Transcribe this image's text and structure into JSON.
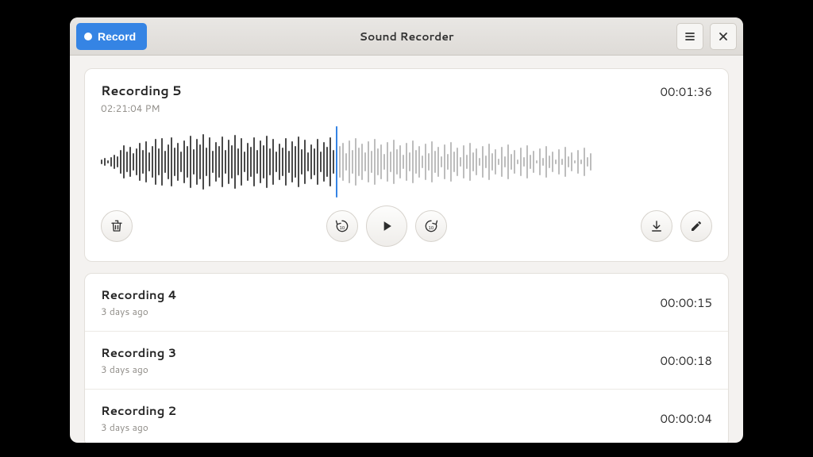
{
  "header": {
    "title": "Sound Recorder",
    "record_label": "Record"
  },
  "selected": {
    "title": "Recording 5",
    "timestamp": "02:21:04 PM",
    "duration": "00:01:36",
    "playhead_fraction": 0.48,
    "waveform_past": [
      6,
      10,
      4,
      12,
      18,
      14,
      30,
      42,
      26,
      38,
      22,
      34,
      48,
      30,
      52,
      24,
      40,
      58,
      34,
      60,
      28,
      44,
      62,
      36,
      48,
      26,
      54,
      40,
      66,
      32,
      58,
      44,
      70,
      36,
      62,
      28,
      50,
      40,
      64,
      30,
      56,
      42,
      68,
      34,
      60,
      26,
      48,
      38,
      62,
      30,
      54,
      42,
      66,
      34,
      58,
      26,
      46,
      36,
      60,
      28,
      52,
      40,
      64,
      32,
      56,
      24,
      44,
      34,
      58,
      26,
      50,
      38,
      62,
      30
    ],
    "waveform_future": [
      40,
      48,
      22,
      54,
      30,
      60,
      36,
      46,
      24,
      52,
      28,
      58,
      34,
      44,
      20,
      50,
      26,
      56,
      32,
      42,
      18,
      48,
      24,
      54,
      30,
      40,
      16,
      46,
      22,
      52,
      28,
      38,
      14,
      44,
      20,
      50,
      26,
      36,
      12,
      42,
      18,
      48,
      24,
      34,
      10,
      40,
      16,
      46,
      22,
      32,
      8,
      38,
      14,
      44,
      20,
      30,
      6,
      36,
      12,
      42,
      18,
      28,
      4,
      34,
      10,
      40,
      16,
      26,
      6,
      32,
      8,
      38,
      14,
      24,
      4,
      30,
      6,
      36,
      12,
      22
    ]
  },
  "recordings": [
    {
      "title": "Recording 4",
      "subtitle": "3 days ago",
      "duration": "00:00:15"
    },
    {
      "title": "Recording 3",
      "subtitle": "3 days ago",
      "duration": "00:00:18"
    },
    {
      "title": "Recording 2",
      "subtitle": "3 days ago",
      "duration": "00:00:04"
    }
  ],
  "icons": {
    "hamburger": "hamburger-icon",
    "close": "close-icon",
    "trash": "trash-icon",
    "back10": "back-10-icon",
    "play": "play-icon",
    "fwd10": "forward-10-icon",
    "download": "download-icon",
    "edit": "edit-icon",
    "record_dot": "record-dot-icon"
  },
  "colors": {
    "accent": "#3584e4"
  }
}
